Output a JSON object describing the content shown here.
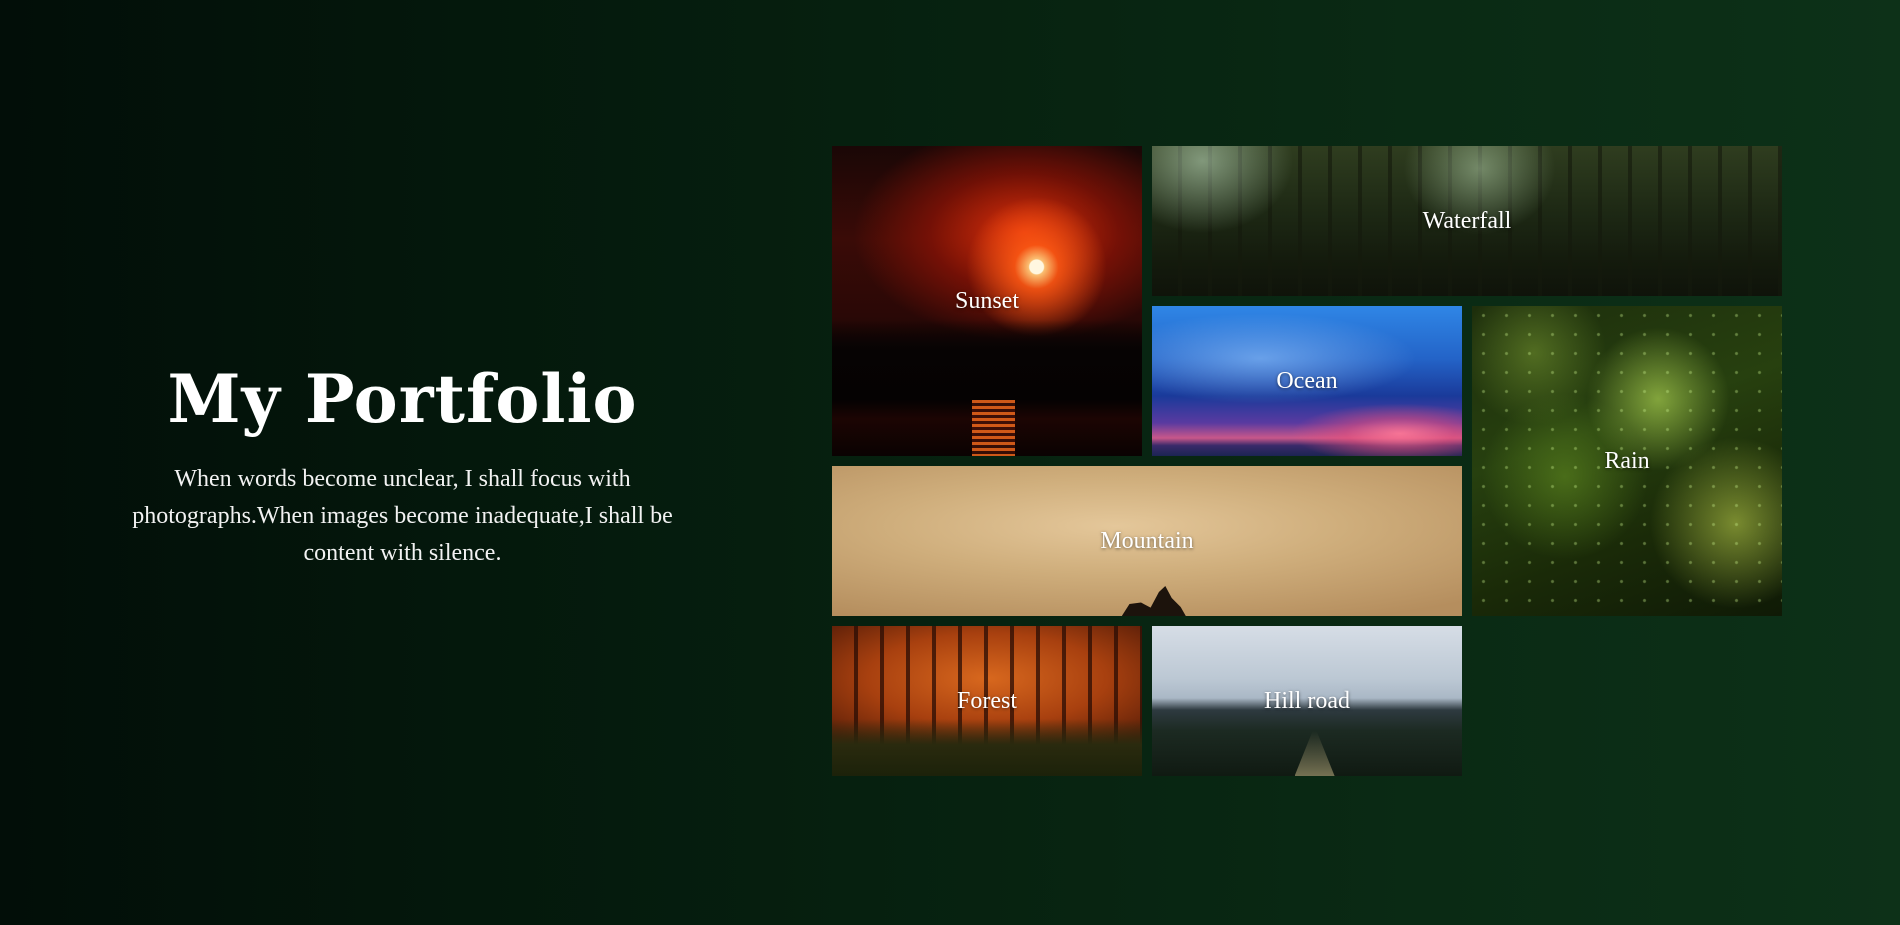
{
  "hero": {
    "title": "My Portfolio",
    "tagline": "When words become unclear, I shall focus with photographs.When images become inadequate,I shall be content with silence."
  },
  "gallery": {
    "items": [
      {
        "label": "Sunset"
      },
      {
        "label": "Waterfall"
      },
      {
        "label": "Ocean"
      },
      {
        "label": "Rain"
      },
      {
        "label": "Mountain"
      },
      {
        "label": "Forest"
      },
      {
        "label": "Hill road"
      }
    ]
  },
  "colors": {
    "background_dark": "#020e08",
    "background_green": "#0d3118",
    "text": "#ffffff"
  }
}
